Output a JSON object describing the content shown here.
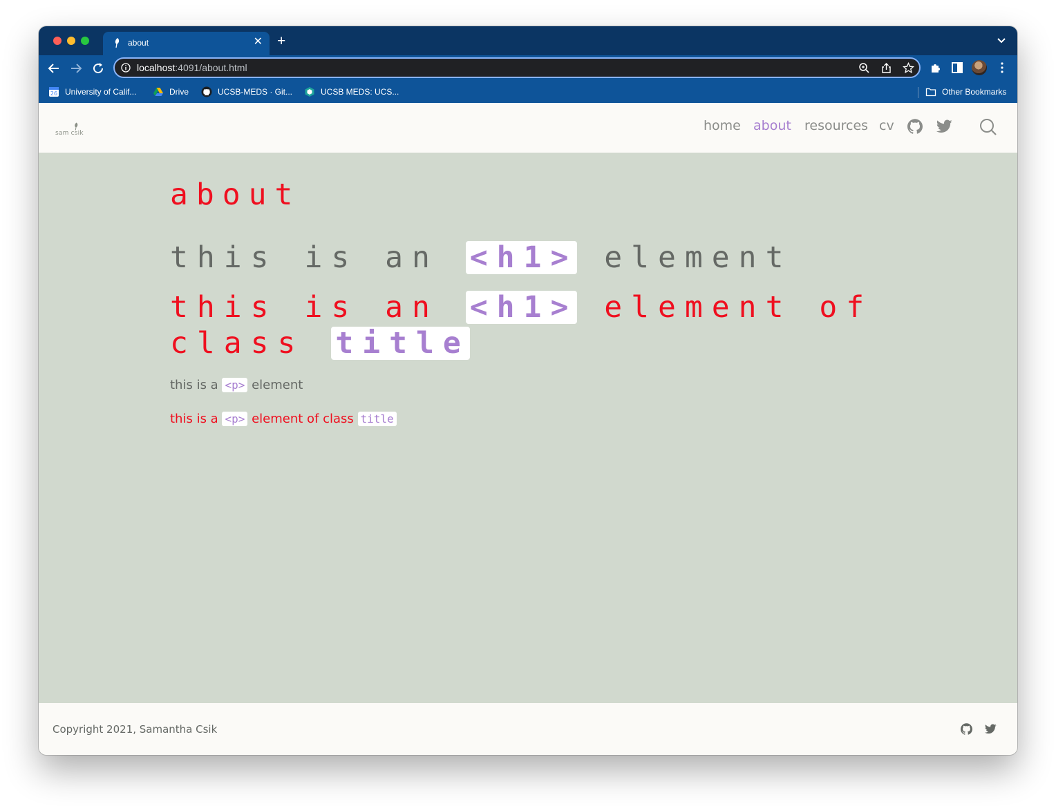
{
  "browser": {
    "tab_title": "about",
    "url_host": "localhost",
    "url_rest": ":4091/about.html",
    "bookmarks": [
      {
        "label": "University of Calif...",
        "icon": "calendar-icon"
      },
      {
        "label": "Drive",
        "icon": "google-drive-icon"
      },
      {
        "label": "UCSB-MEDS · Git...",
        "icon": "github-icon"
      },
      {
        "label": "UCSB MEDS: UCS...",
        "icon": "meds-icon"
      }
    ],
    "other_bookmarks": "Other Bookmarks",
    "colors": {
      "frame": "#0b3563",
      "toolbar": "#0e5499",
      "omnibox": "#202124"
    }
  },
  "site": {
    "logo_text": "sam csik",
    "nav": {
      "home": "home",
      "about": "about",
      "resources": "resources",
      "cv": "cv"
    },
    "colors": {
      "accent": "#a77fd0",
      "title_red": "#ef0f1f",
      "body_bg": "#d1d9ce",
      "header_bg": "#fbfaf7"
    }
  },
  "content": {
    "page_title": "about",
    "h1_plain": {
      "pre": "this is an",
      "code": "<h1>",
      "post": "element"
    },
    "h1_title": {
      "pre": "this is an",
      "code": "<h1>",
      "post1": "element of",
      "post2": "class",
      "code2": "title"
    },
    "p_plain": {
      "pre": "this is a",
      "code": "<p>",
      "post": "element"
    },
    "p_title": {
      "pre": "this is a",
      "code": "<p>",
      "post": "element of class",
      "code2": "title"
    }
  },
  "footer": {
    "copyright": "Copyright 2021, Samantha Csik"
  }
}
